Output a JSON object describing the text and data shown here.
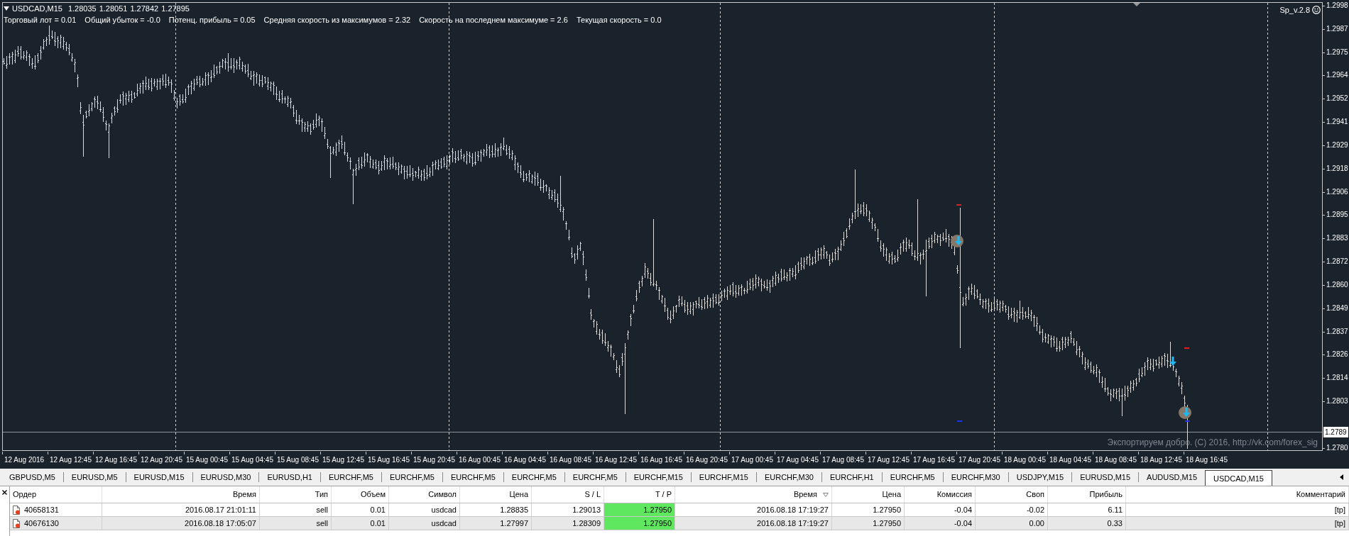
{
  "chart": {
    "header": {
      "symbol": "USDCAD,M15",
      "ohlc": [
        "1.28035",
        "1.28051",
        "1.27842",
        "1.27895"
      ]
    },
    "stats": [
      "Торговый лот = 0.01",
      "Общий убыток = -0.0",
      "Потенц. прибыль = 0.05",
      "Средняя скорость из максимумов = 2.32",
      "Скорость на последнем максимуме = 2.6",
      "Текущая скорость = 0.0"
    ],
    "indicator_label": "Sp_v.2.8",
    "copyright": "Экспортируем добро. (C) 2016, http://vk.com/forex_sig",
    "price_axis": [
      "1.2998",
      "1.2987",
      "1.2975",
      "1.2964",
      "1.2952",
      "1.2941",
      "1.2929",
      "1.2918",
      "1.2906",
      "1.2895",
      "1.2883",
      "1.2872",
      "1.2860",
      "1.2849",
      "1.2837",
      "1.2826",
      "1.2814",
      "1.2803",
      "1.2780"
    ],
    "current_price": "1.2789",
    "time_axis": [
      "12 Aug 2016",
      "12 Aug 12:45",
      "12 Aug 16:45",
      "12 Aug 20:45",
      "15 Aug 00:45",
      "15 Aug 04:45",
      "15 Aug 08:45",
      "15 Aug 12:45",
      "15 Aug 16:45",
      "15 Aug 20:45",
      "16 Aug 00:45",
      "16 Aug 04:45",
      "16 Aug 08:45",
      "16 Aug 12:45",
      "16 Aug 16:45",
      "16 Aug 20:45",
      "17 Aug 00:45",
      "17 Aug 04:45",
      "17 Aug 08:45",
      "17 Aug 12:45",
      "17 Aug 16:45",
      "17 Aug 20:45",
      "18 Aug 00:45",
      "18 Aug 04:45",
      "18 Aug 08:45",
      "18 Aug 12:45",
      "18 Aug 16:45"
    ]
  },
  "tabs": [
    {
      "label": "GBPUSD,M5",
      "selected": false
    },
    {
      "label": "EURUSD,M5",
      "selected": false
    },
    {
      "label": "EURUSD,M15",
      "selected": false
    },
    {
      "label": "EURUSD,M30",
      "selected": false
    },
    {
      "label": "EURUSD,H1",
      "selected": false
    },
    {
      "label": "EURCHF,M5",
      "selected": false
    },
    {
      "label": "EURCHF,M5",
      "selected": false
    },
    {
      "label": "EURCHF,M5",
      "selected": false
    },
    {
      "label": "EURCHF,M5",
      "selected": false
    },
    {
      "label": "EURCHF,M5",
      "selected": false
    },
    {
      "label": "EURCHF,M15",
      "selected": false
    },
    {
      "label": "EURCHF,M15",
      "selected": false
    },
    {
      "label": "EURCHF,M30",
      "selected": false
    },
    {
      "label": "EURCHF,H1",
      "selected": false
    },
    {
      "label": "EURCHF,M5",
      "selected": false
    },
    {
      "label": "EURCHF,M30",
      "selected": false
    },
    {
      "label": "USDJPY,M15",
      "selected": false
    },
    {
      "label": "EURUSD,M15",
      "selected": false
    },
    {
      "label": "AUDUSD,M15",
      "selected": false
    },
    {
      "label": "USDCAD,M15",
      "selected": true
    }
  ],
  "table": {
    "columns": [
      {
        "label": "Ордер",
        "sorted": false
      },
      {
        "label": "Время",
        "sorted": false
      },
      {
        "label": "Тип",
        "sorted": false
      },
      {
        "label": "Объем",
        "sorted": false
      },
      {
        "label": "Символ",
        "sorted": false
      },
      {
        "label": "Цена",
        "sorted": false
      },
      {
        "label": "S / L",
        "sorted": false
      },
      {
        "label": "T / P",
        "sorted": false
      },
      {
        "label": "Время",
        "sorted": true
      },
      {
        "label": "Цена",
        "sorted": false
      },
      {
        "label": "Комиссия",
        "sorted": false
      },
      {
        "label": "Своп",
        "sorted": false
      },
      {
        "label": "Прибыль",
        "sorted": false
      },
      {
        "label": "Комментарий",
        "sorted": false
      }
    ],
    "rows": [
      {
        "cells": [
          "40658131",
          "2016.08.17 21:01:11",
          "sell",
          "0.01",
          "usdcad",
          "1.28835",
          "1.29013",
          "1.27950",
          "2016.08.18 17:19:27",
          "1.27950",
          "-0.04",
          "-0.02",
          "6.11",
          "[tp]"
        ],
        "tp_highlighted": true
      },
      {
        "cells": [
          "40676130",
          "2016.08.18 17:05:07",
          "sell",
          "0.01",
          "usdcad",
          "1.27997",
          "1.28309",
          "1.27950",
          "2016.08.18 17:19:27",
          "1.27950",
          "-0.04",
          "0.00",
          "0.33",
          "[tp]"
        ],
        "tp_highlighted": true
      }
    ]
  }
}
